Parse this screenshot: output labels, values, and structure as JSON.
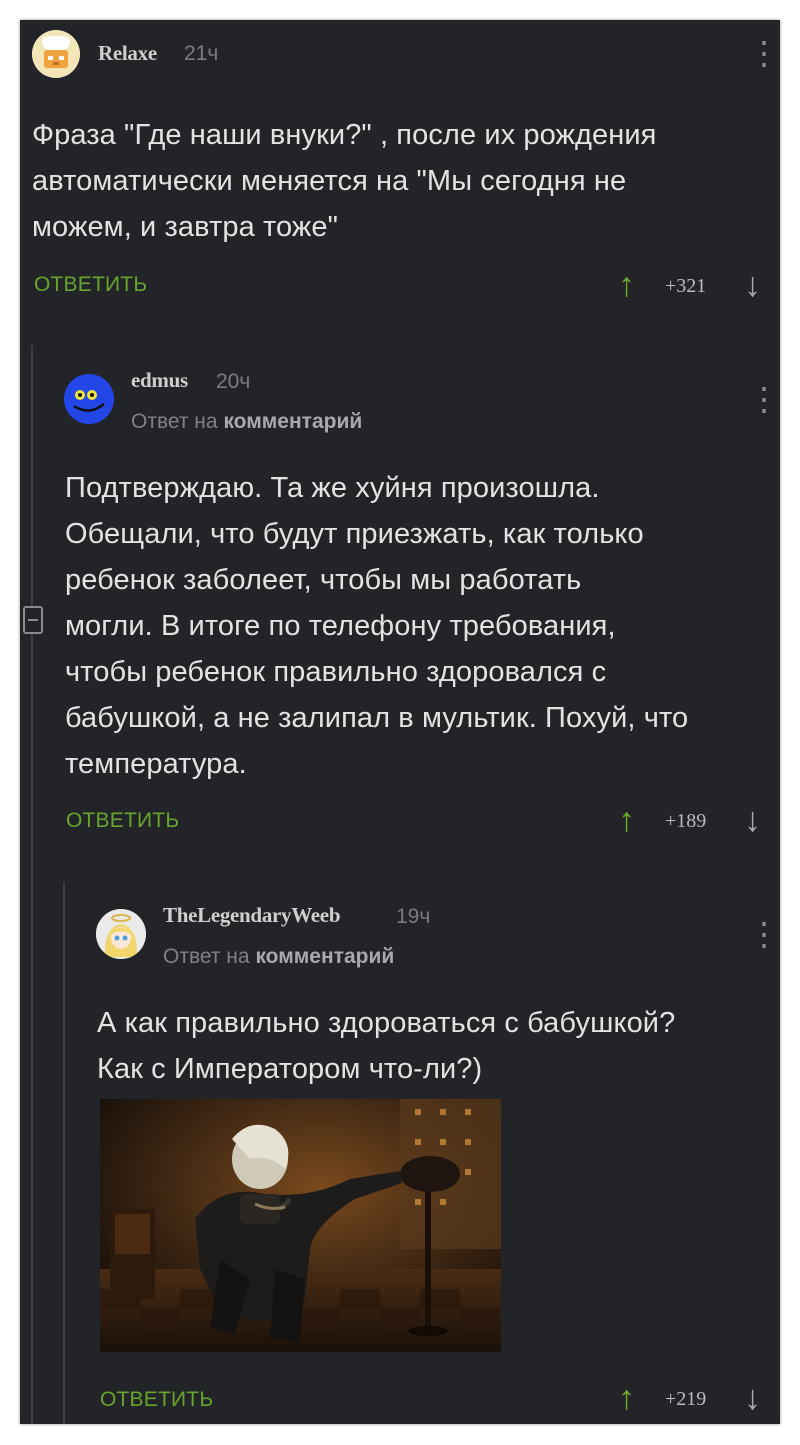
{
  "comments": [
    {
      "user": "Relaxe",
      "time": "21ч",
      "text_lines": [
        "Фраза \"Где наши внуки?\" , после их рождения",
        "автоматически меняется на \"Мы сегодня не",
        "можем, и завтра тоже\""
      ],
      "reply_label": "ОТВЕТИТЬ",
      "rating": "+321"
    },
    {
      "user": "edmus",
      "time": "20ч",
      "reply_to_prefix": "Ответ на",
      "reply_to_link": "комментарий",
      "text_lines": [
        "Подтверждаю. Та же хуйня произошла.",
        "Обещали, что будут приезжать, как только",
        "ребенок заболеет, чтобы мы работать",
        "могли. В итоге по телефону требования,",
        "чтобы ребенок правильно здоровался с",
        "бабушкой, а не залипал в мультик. Похуй, что",
        "температура."
      ],
      "reply_label": "ОТВЕТИТЬ",
      "rating": "+189"
    },
    {
      "user": "TheLegendaryWeeb",
      "time": "19ч",
      "reply_to_prefix": "Ответ на",
      "reply_to_link": "комментарий",
      "text_lines": [
        "А как правильно здороваться с бабушкой?",
        "Как с Императором что-ли?)"
      ],
      "reply_label": "ОТВЕТИТЬ",
      "rating": "+219"
    }
  ],
  "icons": {
    "upvote": "↑",
    "downvote": "↓",
    "menu": "⋮"
  },
  "colors": {
    "background": "#222427",
    "accent_green": "#67a52e",
    "text": "#e3e3e3"
  }
}
